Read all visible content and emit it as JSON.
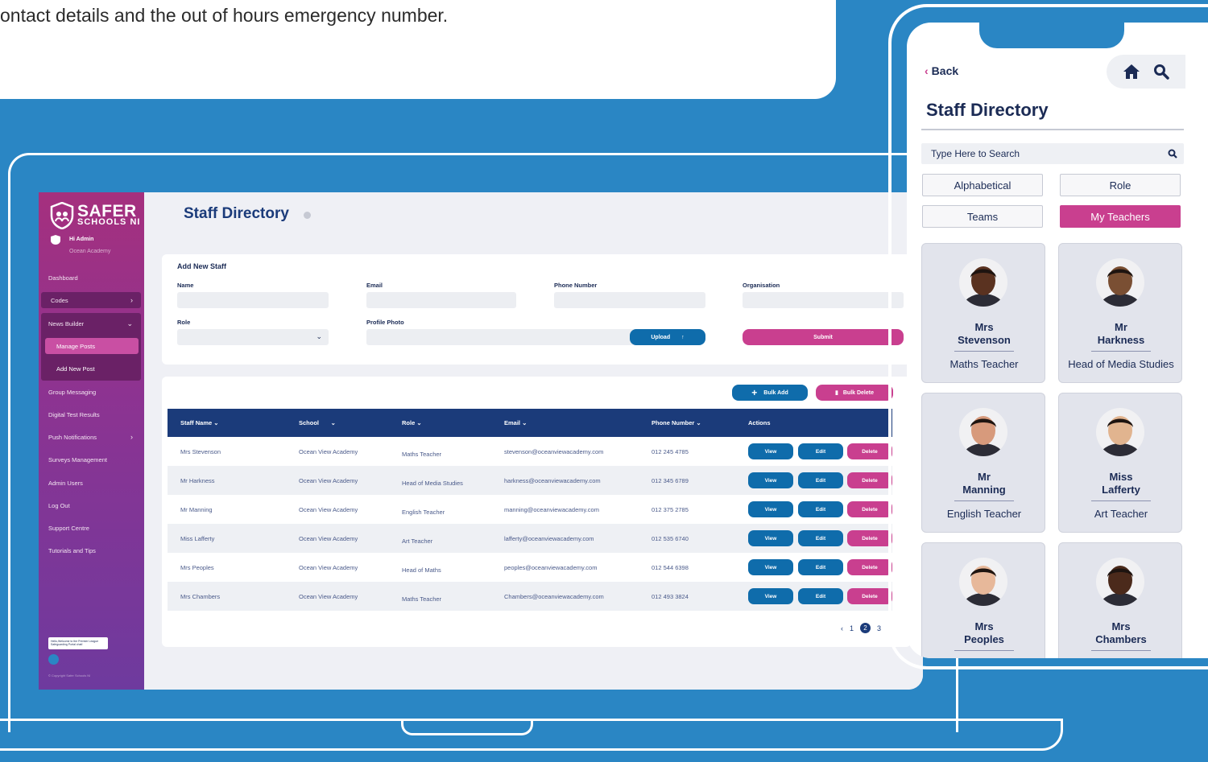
{
  "caption": "ontact details and the out of hours emergency number.",
  "desktop": {
    "sidebar": {
      "logo_main": "SAFER",
      "logo_sub": "SCHOOLS NI",
      "greeting": "Hi Admin",
      "organisation": "Ocean Academy",
      "items": [
        {
          "label": "Dashboard"
        },
        {
          "label": "Codes"
        },
        {
          "label": "News Builder"
        },
        {
          "label": "Manage Posts"
        },
        {
          "label": "Add New Post"
        },
        {
          "label": "Group Messaging"
        },
        {
          "label": "Digital Test Results"
        },
        {
          "label": "Push Notifications"
        },
        {
          "label": "Surveys Management"
        },
        {
          "label": "Admin Users"
        },
        {
          "label": "Log Out"
        },
        {
          "label": "Support Centre"
        },
        {
          "label": "Tutorials and Tips"
        }
      ],
      "chat_text": "Hello,Welcome to the Premier League Safeguarding Portal chat!",
      "copyright": "© Copyright Safer Schools NI"
    },
    "title": "Staff Directory",
    "form": {
      "heading": "Add New Staff",
      "name_label": "Name",
      "email_label": "Email",
      "phone_label": "Phone Number",
      "org_label": "Organisation",
      "role_label": "Role",
      "photo_label": "Profile Photo",
      "upload_label": "Upload",
      "submit_label": "Submit"
    },
    "bulk_add_label": "Bulk Add",
    "bulk_delete_label": "Bulk Delete",
    "table": {
      "headers": [
        "Staff Name",
        "School",
        "Role",
        "Email",
        "Phone Number",
        "Actions"
      ],
      "rows": [
        {
          "name": "Mrs Stevenson",
          "school": "Ocean View Academy",
          "role": "Maths Teacher",
          "email": "stevenson@oceanviewacademy.com",
          "phone": "012 245 4785"
        },
        {
          "name": "Mr Harkness",
          "school": "Ocean View Academy",
          "role": "Head of Media Studies",
          "email": "harkness@oceanviewacademy.com",
          "phone": "012 345 6789"
        },
        {
          "name": "Mr Manning",
          "school": "Ocean View Academy",
          "role": "English Teacher",
          "email": "manning@oceanviewacademy.com",
          "phone": "012 375 2785"
        },
        {
          "name": "Miss Lafferty",
          "school": "Ocean View Academy",
          "role": "Art Teacher",
          "email": "lafferty@oceanviewacademy.com",
          "phone": "012 535 6740"
        },
        {
          "name": "Mrs Peoples",
          "school": "Ocean View Academy",
          "role": "Head of Maths",
          "email": "peoples@oceanviewacademy.com",
          "phone": "012 544 6398"
        },
        {
          "name": "Mrs Chambers",
          "school": "Ocean View Academy",
          "role": "Maths Teacher",
          "email": "Chambers@oceanviewacademy.com",
          "phone": "012 493 3824"
        }
      ],
      "view_label": "View",
      "edit_label": "Edit",
      "delete_label": "Delete"
    },
    "pagination": {
      "prev": "‹",
      "pages": [
        "1",
        "2",
        "3"
      ],
      "current": "2"
    }
  },
  "mobile": {
    "back_label": "Back",
    "title": "Staff Directory",
    "search_placeholder": "Type Here to Search",
    "filters": [
      "Alphabetical",
      "Role",
      "Teams",
      "My Teachers"
    ],
    "active_filter": "My Teachers",
    "teachers": [
      {
        "title": "Mrs",
        "name": "Stevenson",
        "role": "Maths Teacher",
        "skin": "#5a3220"
      },
      {
        "title": "Mr",
        "name": "Harkness",
        "role": "Head of Media Studies",
        "skin": "#7a4f33"
      },
      {
        "title": "Mr",
        "name": "Manning",
        "role": "English Teacher",
        "skin": "#d79a7c"
      },
      {
        "title": "Miss",
        "name": "Lafferty",
        "role": "Art Teacher",
        "skin": "#e1b48f"
      },
      {
        "title": "Mrs",
        "name": "Peoples",
        "role": "",
        "skin": "#e7b89a"
      },
      {
        "title": "Mrs",
        "name": "Chambers",
        "role": "",
        "skin": "#4b2a1b"
      }
    ]
  },
  "colors": {
    "background": "#2a86c4",
    "navy": "#1b3b7a",
    "pink": "#c93f8f",
    "blue_button": "#0f6cab"
  }
}
